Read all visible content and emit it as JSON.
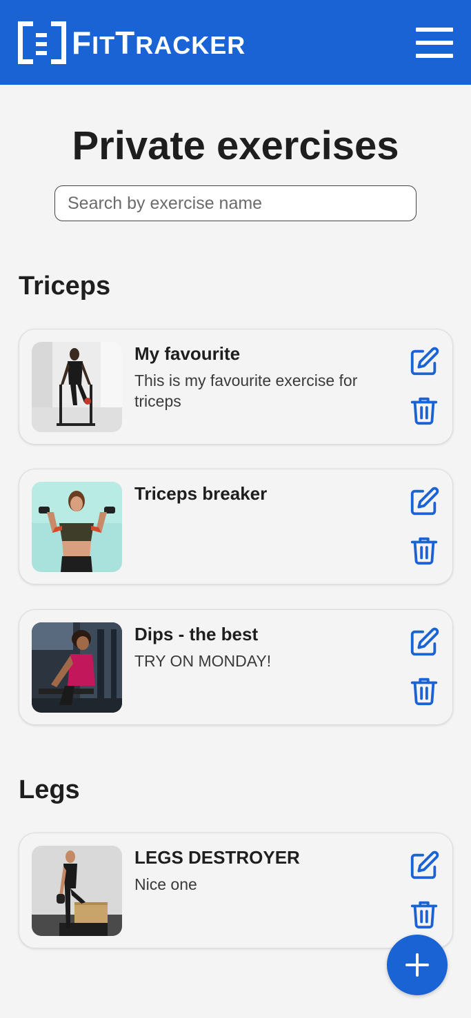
{
  "header": {
    "brand_first_big": "F",
    "brand_first_small": "IT",
    "brand_second_big": "T",
    "brand_second_small": "RACKER",
    "brand_color": "#1a63d4"
  },
  "page": {
    "title": "Private exercises",
    "search_placeholder": "Search by exercise name"
  },
  "sections": [
    {
      "title": "Triceps",
      "exercises": [
        {
          "name": "My favourite",
          "description": "This is my favourite exercise for triceps",
          "image": "man-doing-dips-photo"
        },
        {
          "name": "Triceps breaker",
          "description": "",
          "image": "woman-dumbbell-press-photo"
        },
        {
          "name": "Dips - the best",
          "description": "TRY ON MONDAY!",
          "image": "woman-bench-dips-photo"
        }
      ]
    },
    {
      "title": "Legs",
      "exercises": [
        {
          "name": "LEGS DESTROYER",
          "description": "Nice one",
          "image": "man-box-step-up-photo"
        }
      ]
    }
  ],
  "icons": {
    "edit": "pencil-square-icon",
    "delete": "trash-icon",
    "add": "plus-icon",
    "menu": "hamburger-menu-icon"
  }
}
